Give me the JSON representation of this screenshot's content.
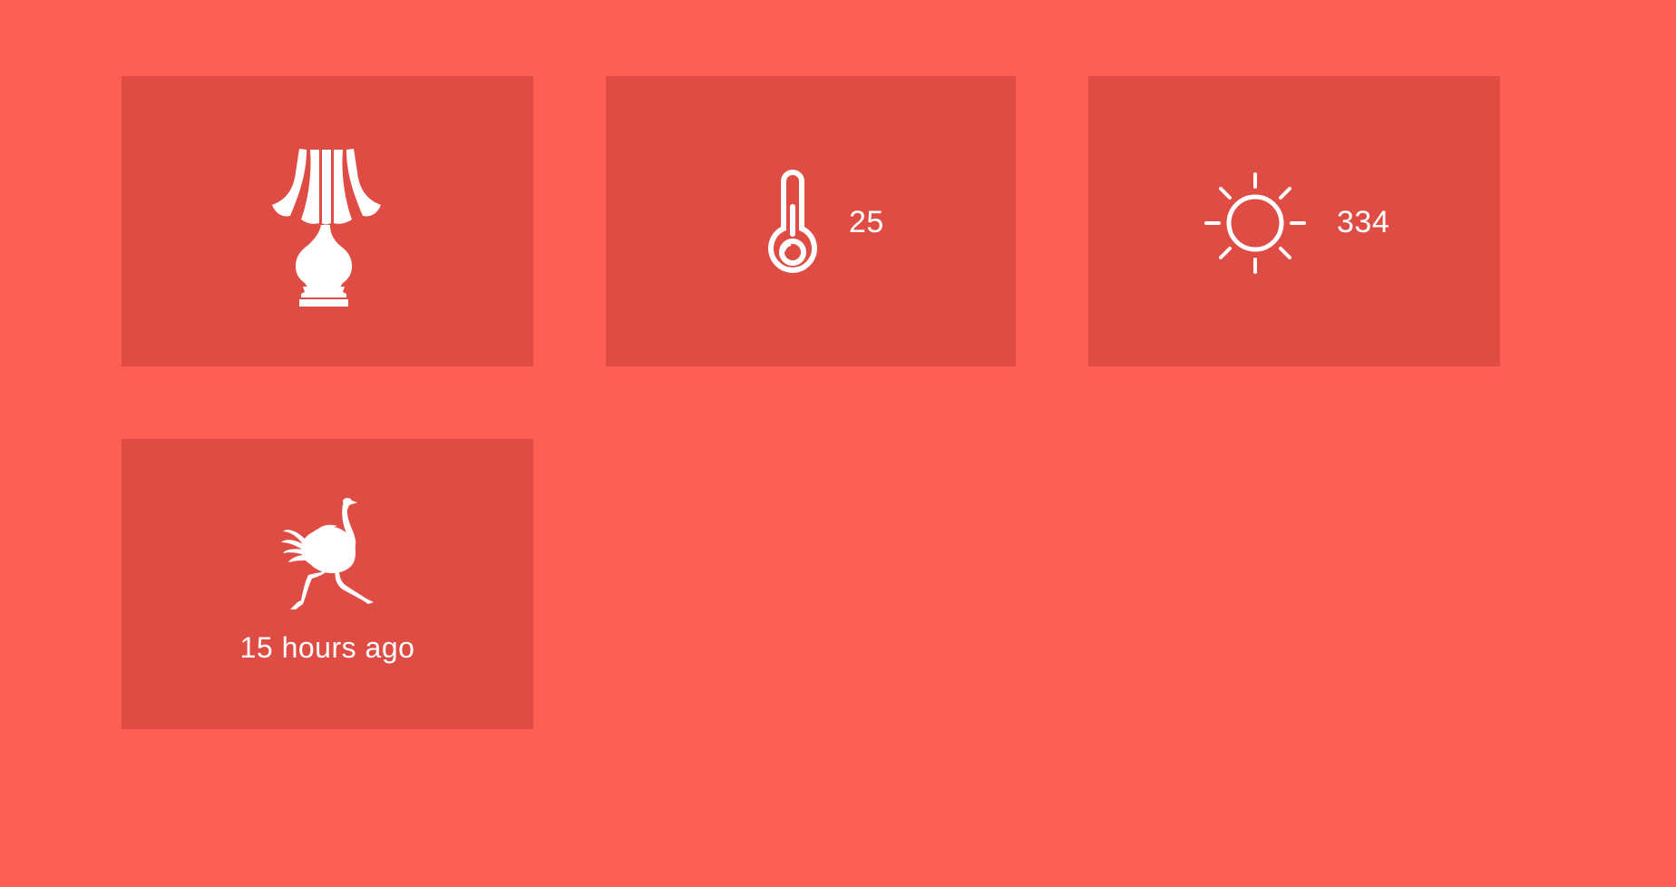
{
  "colors": {
    "background": "#fe5f55",
    "tile": "#de4c44",
    "foreground": "#ffffff"
  },
  "tiles": [
    {
      "id": "lamp",
      "icon": "table-lamp-icon",
      "value": ""
    },
    {
      "id": "temperature",
      "icon": "thermometer-icon",
      "value": "25"
    },
    {
      "id": "light",
      "icon": "sun-icon",
      "value": "334"
    },
    {
      "id": "motion",
      "icon": "ostrich-icon",
      "value": "15 hours ago"
    }
  ]
}
